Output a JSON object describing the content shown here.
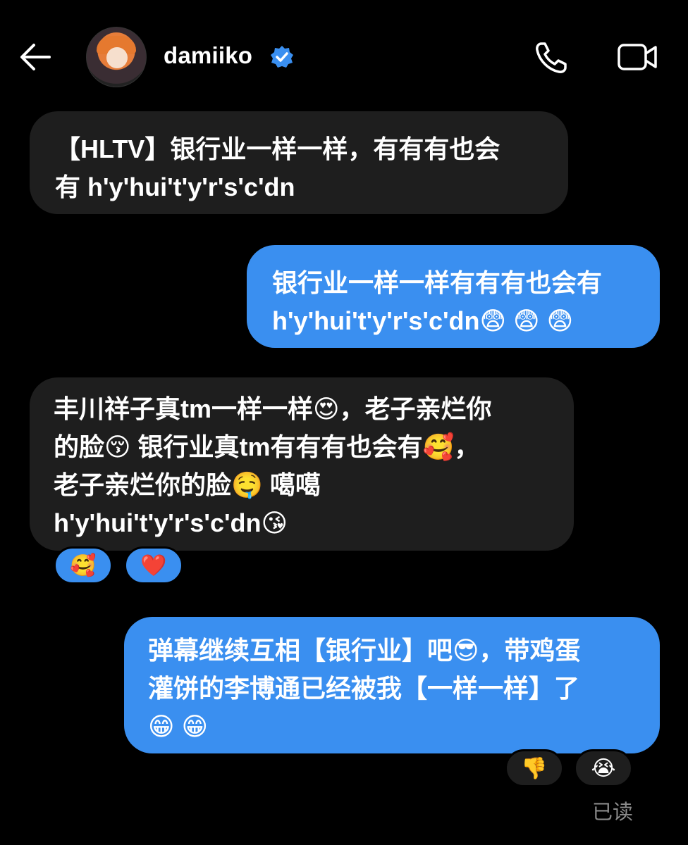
{
  "header": {
    "username": "damiiko",
    "icons": [
      "back-arrow-icon",
      "verified-badge-icon",
      "phone-icon",
      "video-call-icon"
    ],
    "verified_color": "#3a8ff0"
  },
  "messages": [
    {
      "side": "received",
      "lines": [
        "【HLTV】银行业一样一样，有有有也会",
        "有 h'y'hui't'y'r's'c'dn"
      ]
    },
    {
      "side": "sent",
      "lines": [
        "银行业一样一样有有有也会有",
        "h'y'hui't'y'r's'c'dn😨 😨 😨"
      ]
    },
    {
      "side": "received",
      "lines": [
        "丰川祥子真tm一样一样😍，老子亲烂你",
        "的脸😚 银行业真tm有有有也会有🥰，",
        "老子亲烂你的脸🤤 噶噶",
        "h'y'hui't'y'r's'c'dn😘"
      ],
      "reactions": [
        "🥰",
        "❤️"
      ]
    },
    {
      "side": "sent",
      "lines": [
        "弹幕继续互相【银行业】吧😎，带鸡蛋",
        "灌饼的李博通已经被我【一样一样】了",
        "😁 😁"
      ],
      "reactions": [
        "👎",
        "😭"
      ]
    }
  ],
  "read_receipt": "已读",
  "colors": {
    "background": "#000000",
    "received_bubble": "#1e1e1e",
    "sent_bubble": "#3a8ff0"
  }
}
